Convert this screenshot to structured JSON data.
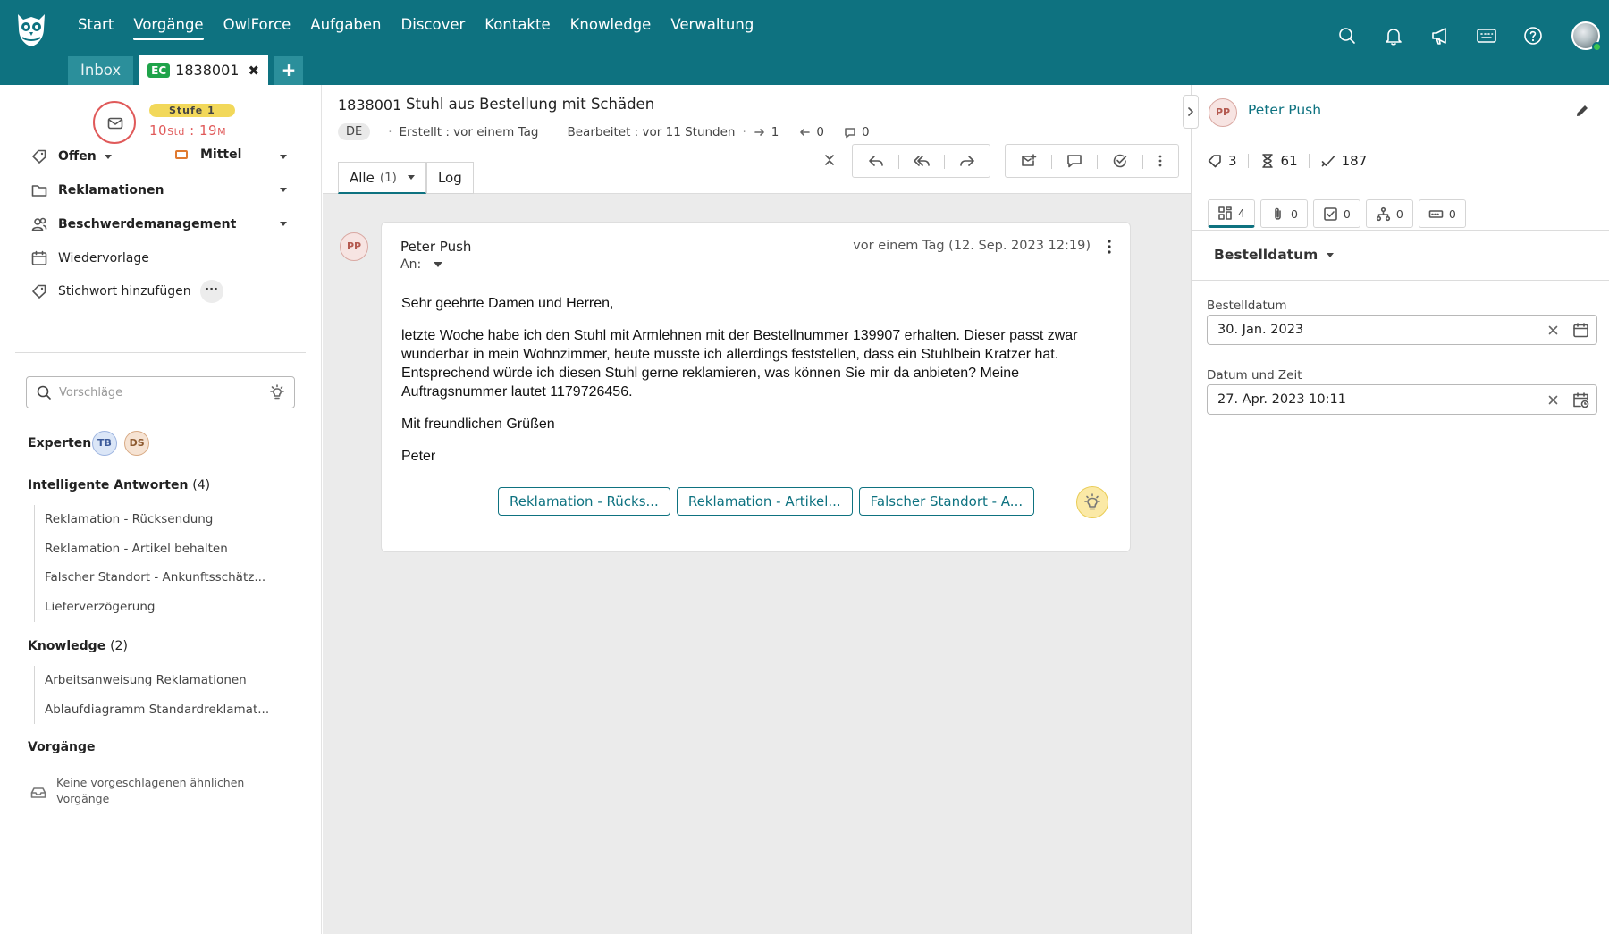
{
  "topnav": {
    "items": [
      "Start",
      "Vorgänge",
      "OwlForce",
      "Aufgaben",
      "Discover",
      "Kontakte",
      "Knowledge",
      "Verwaltung"
    ],
    "active": "Vorgänge"
  },
  "tabs": {
    "inbox": "Inbox",
    "active_badge": "EC",
    "active_id": "1838001",
    "close": "✖",
    "add": "+"
  },
  "sla": {
    "level": "Stufe 1",
    "hours": "10",
    "hours_unit": "Std",
    "sep": " : ",
    "minutes": "19",
    "minutes_unit": "M"
  },
  "sidebar": {
    "status": "Offen",
    "priority": "Mittel",
    "category": "Reklamationen",
    "team": "Beschwerdemanagement",
    "resubmission": "Wiedervorlage",
    "add_tag": "Stichwort hinzufügen",
    "more": "···",
    "suggest_placeholder": "Vorschläge",
    "experts_label": "Experten",
    "experts": [
      "TB",
      "DS"
    ],
    "smart_answers": {
      "title": "Intelligente Antworten",
      "count": "(4)",
      "items": [
        "Reklamation - Rücksendung",
        "Reklamation - Artikel behalten",
        "Falscher Standort - Ankunftsschätz...",
        "Lieferverzögerung"
      ]
    },
    "knowledge": {
      "title": "Knowledge",
      "count": "(2)",
      "items": [
        "Arbeitsanweisung Reklamationen",
        "Ablaufdiagramm Standardreklamat..."
      ]
    },
    "cases": {
      "title": "Vorgänge",
      "empty_line1": "Keine vorgeschlagenen ähnlichen",
      "empty_line2": "Vorgänge"
    }
  },
  "ticket": {
    "id": "1838001",
    "title": "Stuhl aus Bestellung mit Schäden",
    "lang": "DE",
    "created": "Erstellt : vor einem Tag",
    "edited": "Bearbeitet : vor 11 Stunden",
    "outgoing": "1",
    "incoming": "0",
    "comments": "0",
    "view_tabs": {
      "all": "Alle",
      "all_count": "(1)",
      "log": "Log"
    }
  },
  "message": {
    "avatar": "PP",
    "sender": "Peter Push",
    "to_label": "An:",
    "date": "vor einem Tag (12. Sep. 2023 12:19)",
    "body": [
      "Sehr geehrte Damen und Herren,",
      "letzte Woche habe ich den Stuhl mit Armlehnen mit der Bestellnummer 139907 erhalten. Dieser passt zwar wunderbar in mein Wohnzimmer, heute musste ich allerdings feststellen, dass ein Stuhlbein Kratzer hat. Entsprechend würde ich diesen Stuhl gerne reklamieren, was können Sie mir da anbieten? Meine Auftragsnummer lautet 1179726456.",
      "Mit freundlichen Grüßen",
      "Peter"
    ],
    "chips": [
      "Reklamation - Rücks...",
      "Reklamation - Artikel...",
      "Falscher Standort - A..."
    ]
  },
  "contact": {
    "avatar": "PP",
    "name": "Peter Push",
    "stats": {
      "tickets": "3",
      "waiting": "61",
      "done": "187"
    },
    "tabs": [
      "4",
      "0",
      "0",
      "0",
      "0"
    ],
    "field_selector": "Bestelldatum",
    "fields": [
      {
        "label": "Bestelldatum",
        "value": "30. Jan. 2023"
      },
      {
        "label": "Datum und Zeit",
        "value": "27. Apr. 2023 10:11"
      }
    ]
  },
  "colors": {
    "brand": "#0e7280",
    "sla_red": "#e05a5a",
    "sla_level": "#f2d85a",
    "badge_green": "#1fa34a"
  }
}
